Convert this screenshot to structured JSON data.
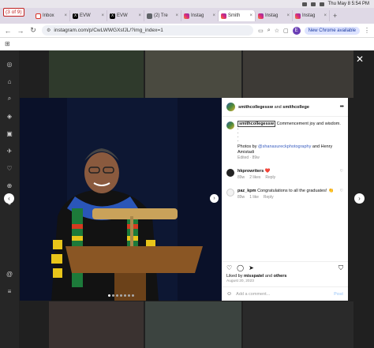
{
  "menubar": {
    "clock": "Thu May 8  5:54 PM"
  },
  "tab_counter": "(3 of 9)",
  "tabs": [
    {
      "label": "Inbox",
      "fav": "gmail"
    },
    {
      "label": "EVW",
      "fav": "x"
    },
    {
      "label": "EVW",
      "fav": "x"
    },
    {
      "label": "(2) Tre",
      "fav": "gen"
    },
    {
      "label": "Instag",
      "fav": "ig"
    },
    {
      "label": "Smith",
      "fav": "ig",
      "active": true
    },
    {
      "label": "Instag",
      "fav": "ig"
    },
    {
      "label": "Instag",
      "fav": "ig"
    }
  ],
  "address": {
    "url": "instagram.com/p/CwLWWGXsfJL/?img_index=1",
    "profile_initial": "E",
    "new_chrome_label": "New Chrome available"
  },
  "post": {
    "header": {
      "user1": "smithcollegessw",
      "and_text": "and",
      "user2": "smithcollege"
    },
    "caption": {
      "username": "smithcollegessw",
      "text": "Commencement joy and wisdom.",
      "dots": [
        ".",
        ".",
        ".",
        "."
      ],
      "credit_prefix": "Photos by ",
      "credit_mention": "@shanasureckphotography",
      "credit_suffix": " and Henry Amistadi",
      "meta": "Edited · 89w"
    },
    "comments": [
      {
        "username": "hkprowriters",
        "text": "❤️",
        "age": "89w",
        "likes": "2 likes",
        "reply": "Reply"
      },
      {
        "username": "paz_kpm",
        "text": "Congratulations to all the graduates! 👏",
        "age": "89w",
        "likes": "1 like",
        "reply": "Reply"
      }
    ],
    "liked_by_prefix": "Liked by ",
    "liked_by_user": "misspatel",
    "liked_by_mid": " and ",
    "liked_by_others": "others",
    "date": "August 20, 2023",
    "add_comment_placeholder": "Add a comment...",
    "post_button": "Post"
  },
  "carousel": {
    "count": 7,
    "active_index": 0
  }
}
